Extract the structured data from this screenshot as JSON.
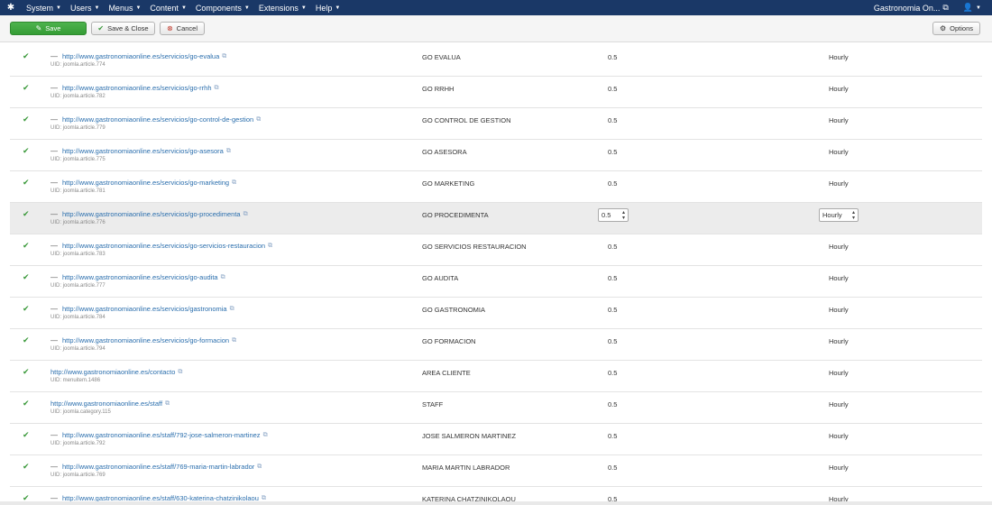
{
  "nav": {
    "menus": [
      "System",
      "Users",
      "Menus",
      "Content",
      "Components",
      "Extensions",
      "Help"
    ],
    "site_label": "Gastronomia On...",
    "icons": {
      "logo": "joomla-logo-icon",
      "caret": "caret-down-icon",
      "external": "external-link-icon",
      "user": "user-icon"
    }
  },
  "toolbar": {
    "save_label": "Save",
    "save_close_label": "Save & Close",
    "cancel_label": "Cancel",
    "options_label": "Options"
  },
  "colors": {
    "navbar": "#1a3867",
    "save": "#46a546",
    "link": "#2a6ead",
    "check": "#3c9a3c"
  },
  "rows": [
    {
      "indent": true,
      "url": "http://www.gastronomiaonline.es/servicios/go-evalua",
      "uid": "UID: joomla.article.774",
      "title": "GO EVALUA",
      "priority": "0.5",
      "frequency": "Hourly"
    },
    {
      "indent": true,
      "url": "http://www.gastronomiaonline.es/servicios/go-rrhh",
      "uid": "UID: joomla.article.782",
      "title": "GO RRHH",
      "priority": "0.5",
      "frequency": "Hourly"
    },
    {
      "indent": true,
      "url": "http://www.gastronomiaonline.es/servicios/go-control-de-gestion",
      "uid": "UID: joomla.article.779",
      "title": "GO CONTROL DE GESTION",
      "priority": "0.5",
      "frequency": "Hourly"
    },
    {
      "indent": true,
      "url": "http://www.gastronomiaonline.es/servicios/go-asesora",
      "uid": "UID: joomla.article.775",
      "title": "GO ASESORA",
      "priority": "0.5",
      "frequency": "Hourly"
    },
    {
      "indent": true,
      "url": "http://www.gastronomiaonline.es/servicios/go-marketing",
      "uid": "UID: joomla.article.781",
      "title": "GO MARKETING",
      "priority": "0.5",
      "frequency": "Hourly"
    },
    {
      "indent": true,
      "url": "http://www.gastronomiaonline.es/servicios/go-procedimenta",
      "uid": "UID: joomla.article.776",
      "title": "GO PROCEDIMENTA",
      "priority": "0.5",
      "frequency": "Hourly",
      "editing": true
    },
    {
      "indent": true,
      "url": "http://www.gastronomiaonline.es/servicios/go-servicios-restauracion",
      "uid": "UID: joomla.article.783",
      "title": "GO SERVICIOS RESTAURACION",
      "priority": "0.5",
      "frequency": "Hourly"
    },
    {
      "indent": true,
      "url": "http://www.gastronomiaonline.es/servicios/go-audita",
      "uid": "UID: joomla.article.777",
      "title": "GO AUDITA",
      "priority": "0.5",
      "frequency": "Hourly"
    },
    {
      "indent": true,
      "url": "http://www.gastronomiaonline.es/servicios/gastronomia",
      "uid": "UID: joomla.article.784",
      "title": "GO GASTRONOMIA",
      "priority": "0.5",
      "frequency": "Hourly"
    },
    {
      "indent": true,
      "url": "http://www.gastronomiaonline.es/servicios/go-formacion",
      "uid": "UID: joomla.article.794",
      "title": "GO FORMACION",
      "priority": "0.5",
      "frequency": "Hourly"
    },
    {
      "indent": false,
      "url": "http://www.gastronomiaonline.es/contacto",
      "uid": "UID: menuitem.1486",
      "title": "AREA CLIENTE",
      "priority": "0.5",
      "frequency": "Hourly"
    },
    {
      "indent": false,
      "url": "http://www.gastronomiaonline.es/staff",
      "uid": "UID: joomla.category.115",
      "title": "STAFF",
      "priority": "0.5",
      "frequency": "Hourly"
    },
    {
      "indent": true,
      "url": "http://www.gastronomiaonline.es/staff/792-jose-salmeron-martinez",
      "uid": "UID: joomla.article.792",
      "title": "JOSE SALMERON MARTINEZ",
      "priority": "0.5",
      "frequency": "Hourly"
    },
    {
      "indent": true,
      "url": "http://www.gastronomiaonline.es/staff/769-maria-martin-labrador",
      "uid": "UID: joomla.article.769",
      "title": "MARIA MARTIN LABRADOR",
      "priority": "0.5",
      "frequency": "Hourly"
    },
    {
      "indent": true,
      "url": "http://www.gastronomiaonline.es/staff/630-katerina-chatzinikolaou",
      "uid": "",
      "title": "KATERINA CHATZINIKOLAOU",
      "priority": "0.5",
      "frequency": "Hourly"
    }
  ]
}
